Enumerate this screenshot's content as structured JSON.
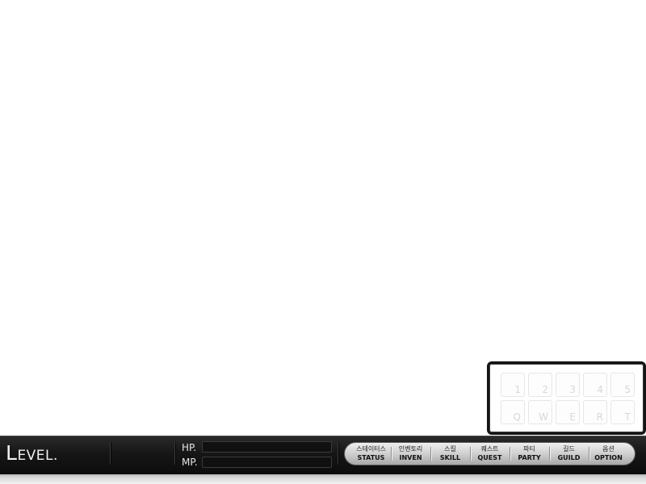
{
  "quickslots": {
    "top_row": [
      "1",
      "2",
      "3",
      "4",
      "5"
    ],
    "bottom_row": [
      "Q",
      "W",
      "E",
      "R",
      "T"
    ]
  },
  "hud": {
    "level": {
      "first_letter": "L",
      "rest": "EVEL",
      "dot": "."
    },
    "hp_label": "HP.",
    "mp_label": "MP."
  },
  "menu": {
    "status": {
      "ko": "스테이터스",
      "en": "STATUS"
    },
    "inven": {
      "ko": "인벤토리",
      "en": "INVEN"
    },
    "skill": {
      "ko": "스킬",
      "en": "SKILL"
    },
    "quest": {
      "ko": "퀘스트",
      "en": "QUEST"
    },
    "party": {
      "ko": "파티",
      "en": "PARTY"
    },
    "guild": {
      "ko": "길드",
      "en": "GUILD"
    },
    "option": {
      "ko": "옵션",
      "en": "OPTION"
    }
  },
  "colors": {
    "hud_background": "#161616",
    "menu_pill": "#cfcfcf",
    "slot_key_text": "#d8d8d8"
  }
}
